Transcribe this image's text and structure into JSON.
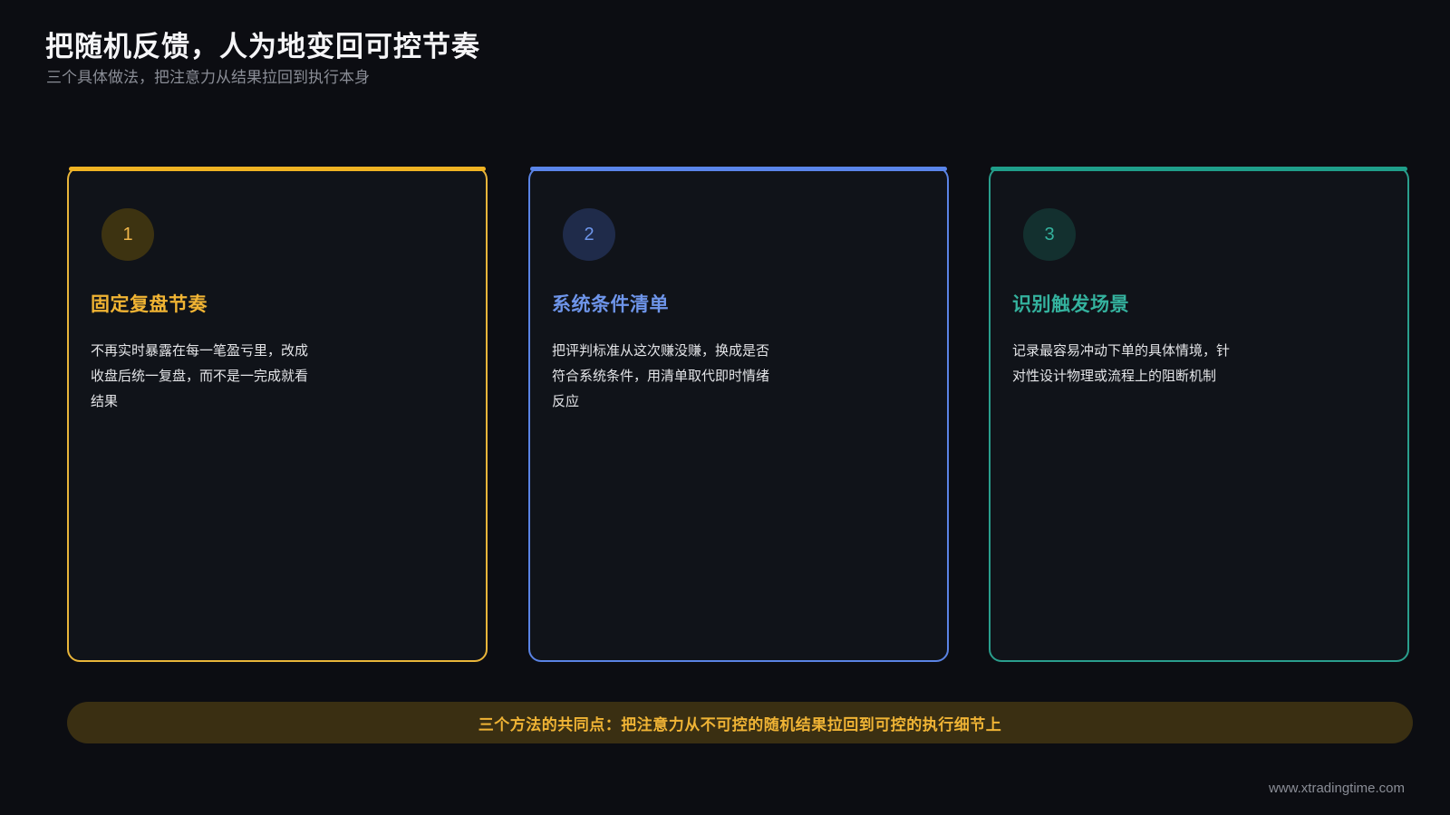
{
  "header": {
    "title": "把随机反馈，人为地变回可控节奏",
    "subtitle": "三个具体做法，把注意力从结果拉回到执行本身"
  },
  "cards": [
    {
      "number": "1",
      "title": "固定复盘节奏",
      "body": "不再实时暴露在每一笔盈亏里，改成收盘后统一复盘，而不是一完成就看结果",
      "accent": "#f0b323"
    },
    {
      "number": "2",
      "title": "系统条件清单",
      "body": "把评判标准从这次赚没赚，换成是否符合系统条件，用清单取代即时情绪反应",
      "accent": "#5a85ea"
    },
    {
      "number": "3",
      "title": "识别触发场景",
      "body": "记录最容易冲动下单的具体情境，针对性设计物理或流程上的阻断机制",
      "accent": "#1f9e8a"
    }
  ],
  "banner": {
    "text": "三个方法的共同点：把注意力从不可控的随机结果拉回到可控的执行细节上"
  },
  "footer": {
    "url": "www.xtradingtime.com"
  }
}
